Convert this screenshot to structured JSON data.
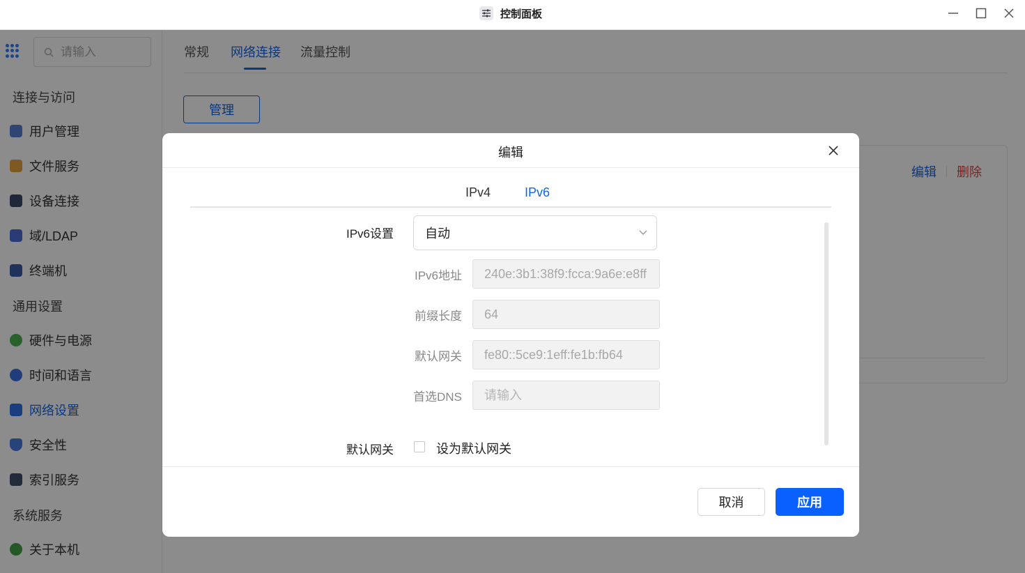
{
  "window": {
    "title": "控制面板",
    "app_icon": "sliders-icon"
  },
  "sidebar": {
    "search_placeholder": "请输入",
    "sections": [
      {
        "title": "连接与访问"
      },
      {
        "title": "通用设置"
      },
      {
        "title": "系统服务"
      }
    ],
    "items": [
      {
        "label": "用户管理",
        "icon": "user-icon"
      },
      {
        "label": "文件服务",
        "icon": "folder-icon"
      },
      {
        "label": "设备连接",
        "icon": "device-icon"
      },
      {
        "label": "域/LDAP",
        "icon": "domain-icon"
      },
      {
        "label": "终端机",
        "icon": "terminal-icon"
      },
      {
        "label": "硬件与电源",
        "icon": "power-icon"
      },
      {
        "label": "时间和语言",
        "icon": "globe-icon"
      },
      {
        "label": "网络设置",
        "icon": "network-icon",
        "active": true
      },
      {
        "label": "安全性",
        "icon": "shield-icon"
      },
      {
        "label": "索引服务",
        "icon": "index-icon"
      },
      {
        "label": "关于本机",
        "icon": "info-icon"
      }
    ]
  },
  "main": {
    "tabs": [
      {
        "label": "常规"
      },
      {
        "label": "网络连接",
        "active": true
      },
      {
        "label": "流量控制"
      }
    ],
    "manage_button": "管理",
    "card_actions": {
      "edit": "编辑",
      "delete": "删除"
    }
  },
  "modal": {
    "title": "编辑",
    "tabs": [
      {
        "label": "IPv4"
      },
      {
        "label": "IPv6",
        "active": true
      }
    ],
    "ipv6_setting_label": "IPv6设置",
    "ipv6_setting_value": "自动",
    "fields": [
      {
        "label": "IPv6地址",
        "value": "240e:3b1:38f9:fcca:9a6e:e8ff",
        "placeholder": ""
      },
      {
        "label": "前缀长度",
        "value": "64",
        "placeholder": ""
      },
      {
        "label": "默认网关",
        "value": "fe80::5ce9:1eff:fe1b:fb64",
        "placeholder": ""
      },
      {
        "label": "首选DNS",
        "value": "",
        "placeholder": "请输入"
      }
    ],
    "default_gateway_label": "默认网关",
    "default_gateway_checkbox_label": "设为默认网关",
    "default_gateway_checked": false,
    "cancel_button": "取消",
    "apply_button": "应用"
  },
  "colors": {
    "accent": "#1565e6",
    "apply_button": "#0a60ff",
    "danger": "#e03c3c",
    "overlay": "rgba(0,0,0,0.45)"
  }
}
